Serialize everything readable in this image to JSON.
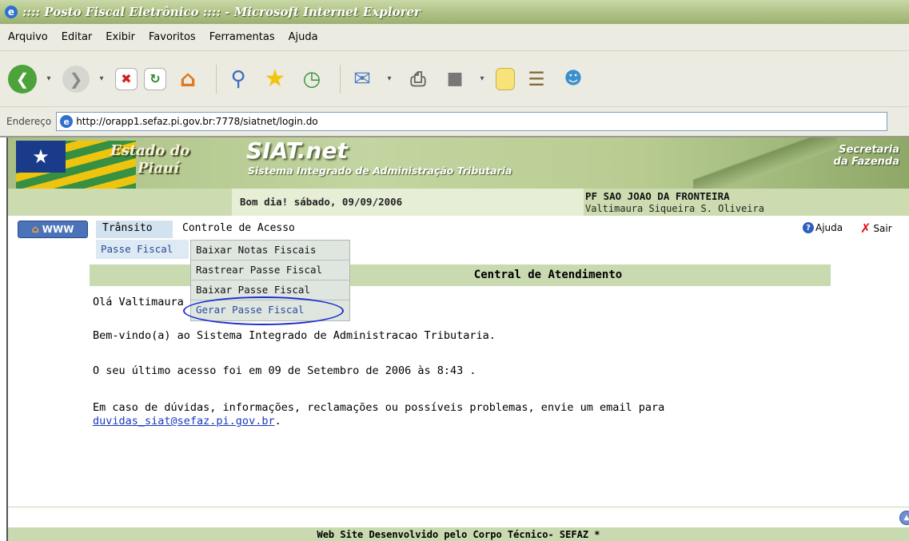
{
  "window": {
    "title": ":::: Posto Fiscal Eletrônico :::: - Microsoft Internet Explorer"
  },
  "menubar": [
    "Arquivo",
    "Editar",
    "Exibir",
    "Favoritos",
    "Ferramentas",
    "Ajuda"
  ],
  "toolbar": {
    "icons": [
      "back-icon",
      "forward-icon",
      "stop-icon",
      "refresh-icon",
      "home-icon",
      "search-icon",
      "favorites-star-icon",
      "history-icon",
      "mail-icon",
      "print-icon",
      "edit-icon",
      "note-icon",
      "research-icon",
      "messenger-icon"
    ]
  },
  "address": {
    "label": "Endereço",
    "url": "http://orapp1.sefaz.pi.gov.br:7778/siatnet/login.do"
  },
  "header": {
    "state_line1": "Estado do",
    "state_line2": "Piauí",
    "brand": "SIAT.net",
    "brand_sub": "Sistema Integrado de Administração Tributaria",
    "secretaria_line1": "Secretaria",
    "secretaria_line2": "da Fazenda"
  },
  "subheader": {
    "greeting": "Bom dia! sábado, 09/09/2006",
    "station": "PF SAO JOAO DA FRONTEIRA",
    "user": "Valtimaura Siqueira S. Oliveira"
  },
  "nav": {
    "www": "WWW",
    "transito": "Trânsito",
    "controle": "Controle de Acesso",
    "ajuda": "Ajuda",
    "sair": "Sair"
  },
  "submenu": {
    "passe": "Passe Fiscal",
    "items": [
      "Baixar Notas Fiscais",
      "Rastrear Passe Fiscal",
      "Baixar Passe Fiscal",
      "Gerar Passe Fiscal"
    ]
  },
  "central": {
    "title": "Central de Atendimento"
  },
  "content": {
    "hello": "Olá Valtimaura",
    "welcome": "Bem-vindo(a) ao Sistema Integrado de Administracao Tributaria.",
    "last_access": "O seu último acesso foi em 09 de Setembro de 2006 às 8:43 .",
    "help_text": "Em caso de dúvidas, informações, reclamações ou possíveis problemas, envie um email para",
    "email": "duvidas_siat@sefaz.pi.gov.br",
    "email_suffix": "."
  },
  "footer": {
    "text": "Web Site Desenvolvido pelo Corpo Técnico- SEFAZ *"
  }
}
